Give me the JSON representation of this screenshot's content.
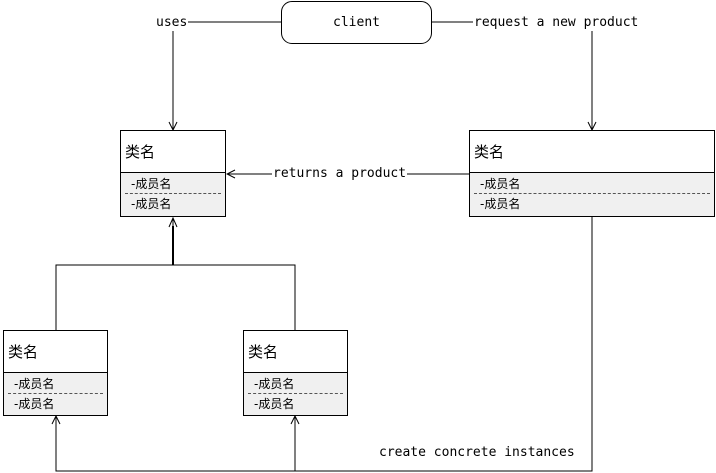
{
  "client": {
    "label": "client"
  },
  "edges": {
    "uses": "uses",
    "request": "request a new product",
    "returns": "returns a product",
    "create": "create concrete instances"
  },
  "classes": [
    {
      "name": "类名",
      "members": [
        "-成员名",
        "-成员名"
      ]
    },
    {
      "name": "类名",
      "members": [
        "-成员名",
        "-成员名"
      ]
    },
    {
      "name": "类名",
      "members": [
        "-成员名",
        "-成员名"
      ]
    },
    {
      "name": "类名",
      "members": [
        "-成员名",
        "-成员名"
      ]
    }
  ]
}
